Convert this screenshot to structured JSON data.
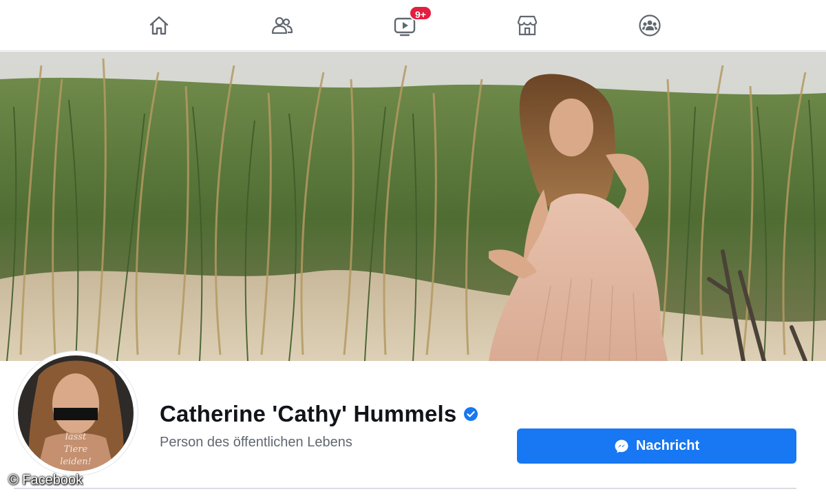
{
  "nav": {
    "items": [
      {
        "name": "home",
        "icon": "home-icon"
      },
      {
        "name": "friends",
        "icon": "friends-icon"
      },
      {
        "name": "watch",
        "icon": "video-icon",
        "badge": "9+"
      },
      {
        "name": "marketplace",
        "icon": "store-icon"
      },
      {
        "name": "groups",
        "icon": "groups-icon"
      }
    ]
  },
  "profile": {
    "name": "Catherine 'Cathy' Hummels",
    "verified_icon": "verified-check-icon",
    "subtitle": "Person des öffentlichen Lebens",
    "avatar_text": "lasst Tiere leiden!",
    "message_button": {
      "label": "Nachricht",
      "icon": "messenger-icon"
    }
  },
  "credit": "© Facebook",
  "colors": {
    "accent": "#1877f2",
    "badge": "#e41e3f",
    "text_primary": "#111418",
    "text_secondary": "#606770"
  }
}
